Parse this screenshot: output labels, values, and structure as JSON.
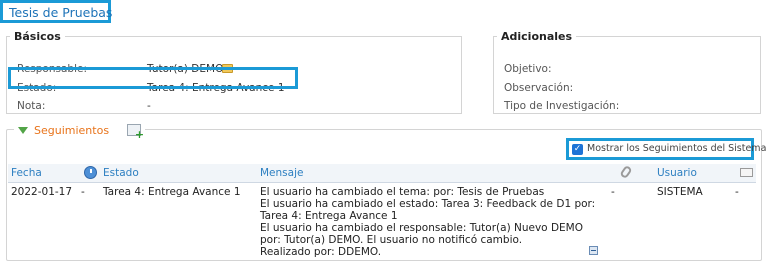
{
  "page_title": "Tesis de Pruebas",
  "basicos": {
    "legend": "Básicos",
    "rows": [
      {
        "label": "Responsable:",
        "value": "Tutor(a) DEMO"
      },
      {
        "label": "Estado:",
        "value": "Tarea 4: Entrega Avance 1"
      },
      {
        "label": "Nota:",
        "value": "-"
      }
    ]
  },
  "adicionales": {
    "legend": "Adicionales",
    "rows": [
      {
        "label": "Objetivo:"
      },
      {
        "label": "Observación:"
      },
      {
        "label": "Tipo de Investigación:"
      }
    ]
  },
  "seguimientos": {
    "title": "Seguimientos",
    "show_system_label": "Mostrar los Seguimientos del Sistema",
    "show_system_checked": true,
    "columns": {
      "fecha": "Fecha",
      "estado": "Estado",
      "mensaje": "Mensaje",
      "usuario": "Usuario"
    },
    "row": {
      "fecha": "2022-01-17",
      "clock": "-",
      "estado": "Tarea 4: Entrega Avance 1",
      "mensaje_lines": [
        "El usuario ha cambiado el tema: por: Tesis de Pruebas",
        "El usuario ha cambiado el estado: Tarea 3: Feedback de D1 por:",
        "Tarea 4: Entrega Avance 1",
        "El usuario ha cambiado el responsable: Tutor(a) Nuevo DEMO",
        "por: Tutor(a) DEMO. El usuario no notificó cambio.",
        "Realizado por: DDEMO."
      ],
      "adjunto": "-",
      "usuario": "SISTEMA",
      "mail": "-"
    }
  }
}
